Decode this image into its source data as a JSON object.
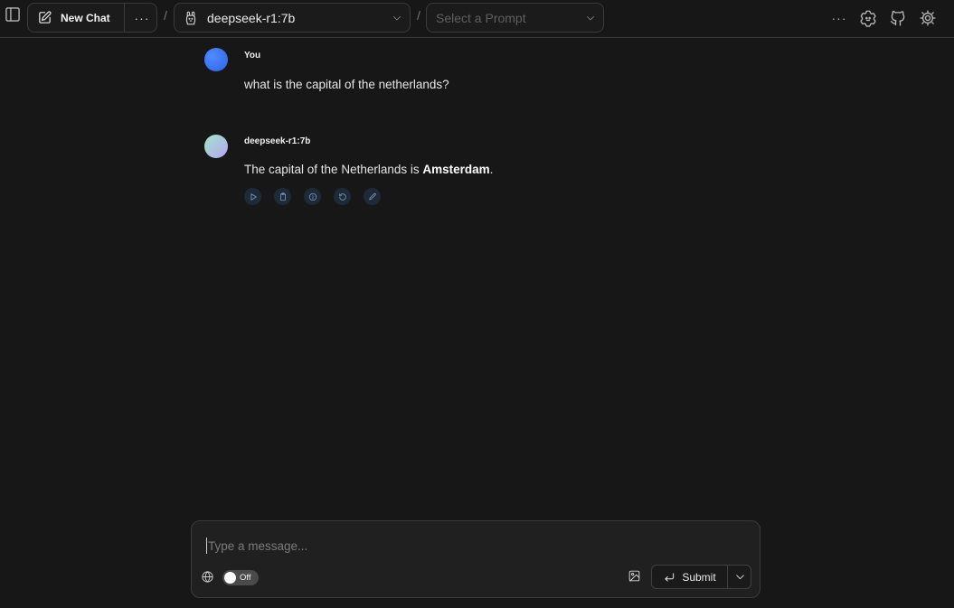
{
  "header": {
    "new_chat_label": "New Chat",
    "more_label": "···",
    "separator": "/",
    "model_label": "deepseek-r1:7b",
    "prompt_placeholder": "Select a Prompt",
    "right_more_label": "···",
    "icons": [
      "sidebar-toggle-icon",
      "edit-icon",
      "llama-icon",
      "chevron-down-icon",
      "bot-settings-icon",
      "github-icon",
      "gear-icon"
    ]
  },
  "messages": [
    {
      "sender": "You",
      "text": "what is the capital of the netherlands?",
      "avatar_color": "#3b76f6"
    },
    {
      "sender": "deepseek-r1:7b",
      "text_before": "The capital of the Netherlands is ",
      "text_bold": "Amsterdam",
      "text_after": ".",
      "avatar_gradient": [
        "#a1e6c4",
        "#b6a4f6"
      ],
      "actions": [
        "play-icon",
        "clipboard-icon",
        "info-icon",
        "regenerate-icon",
        "edit-icon"
      ]
    }
  ],
  "composer": {
    "placeholder": "Type a message...",
    "web_search_state": "Off",
    "submit_label": "Submit"
  },
  "colors": {
    "background": "#171717",
    "border": "#3a3a3a",
    "action_button_bg": "#1f2a38"
  }
}
